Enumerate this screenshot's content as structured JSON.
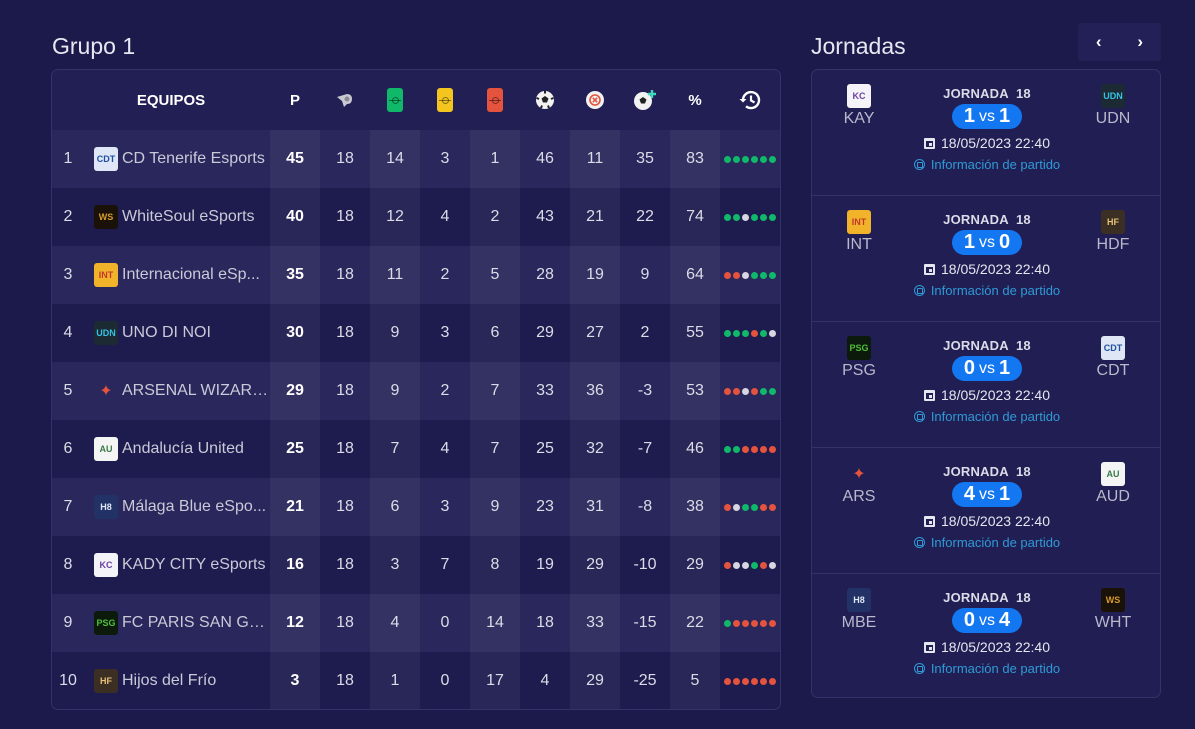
{
  "group": {
    "title": "Grupo 1",
    "headers": {
      "teams": "EQUIPOS",
      "points": "P",
      "played_icon": "whistle-icon",
      "won_icon": "green-pitch-icon",
      "drawn_icon": "yellow-pitch-icon",
      "lost_icon": "red-pitch-icon",
      "goals_for_icon": "soccer-ball-icon",
      "goals_against_icon": "soccer-ball-cross-icon",
      "goal_diff_icon": "soccer-ball-plus-icon",
      "percent": "%",
      "form_icon": "history-icon"
    },
    "colors": {
      "won": "#10b96a",
      "drawn": "#f4c51f",
      "lost": "#e4533d",
      "draw_dot": "#d6d5e0",
      "accent": "#1377f2",
      "link": "#2f9ad6"
    },
    "rows": [
      {
        "pos": "1",
        "team": "CD Tenerife Esports",
        "logo": "tenerife-logo",
        "pts": "45",
        "pj": "18",
        "w": "14",
        "d": "3",
        "l": "1",
        "gf": "46",
        "ga": "11",
        "gd": "35",
        "pct": "83",
        "form": [
          "G",
          "G",
          "G",
          "G",
          "G",
          "G"
        ]
      },
      {
        "pos": "2",
        "team": "WhiteSoul eSports",
        "logo": "whitesoul-logo",
        "pts": "40",
        "pj": "18",
        "w": "12",
        "d": "4",
        "l": "2",
        "gf": "43",
        "ga": "21",
        "gd": "22",
        "pct": "74",
        "form": [
          "G",
          "G",
          "D",
          "G",
          "G",
          "G"
        ]
      },
      {
        "pos": "3",
        "team": "Internacional eSp...",
        "logo": "internacional-logo",
        "pts": "35",
        "pj": "18",
        "w": "11",
        "d": "2",
        "l": "5",
        "gf": "28",
        "ga": "19",
        "gd": "9",
        "pct": "64",
        "form": [
          "R",
          "R",
          "D",
          "G",
          "G",
          "G"
        ]
      },
      {
        "pos": "4",
        "team": "UNO DI NOI",
        "logo": "uno-di-noi-logo",
        "pts": "30",
        "pj": "18",
        "w": "9",
        "d": "3",
        "l": "6",
        "gf": "29",
        "ga": "27",
        "gd": "2",
        "pct": "55",
        "form": [
          "G",
          "G",
          "G",
          "R",
          "G",
          "D"
        ]
      },
      {
        "pos": "5",
        "team": "ARSENAL WIZARDS",
        "logo": "arsenal-wizards-logo",
        "pts": "29",
        "pj": "18",
        "w": "9",
        "d": "2",
        "l": "7",
        "gf": "33",
        "ga": "36",
        "gd": "-3",
        "pct": "53",
        "form": [
          "R",
          "R",
          "D",
          "R",
          "G",
          "G"
        ]
      },
      {
        "pos": "6",
        "team": "Andalucía United",
        "logo": "andalucia-united-logo",
        "pts": "25",
        "pj": "18",
        "w": "7",
        "d": "4",
        "l": "7",
        "gf": "25",
        "ga": "32",
        "gd": "-7",
        "pct": "46",
        "form": [
          "G",
          "G",
          "R",
          "R",
          "R",
          "R"
        ]
      },
      {
        "pos": "7",
        "team": "Málaga Blue eSpo...",
        "logo": "malaga-blue-logo",
        "pts": "21",
        "pj": "18",
        "w": "6",
        "d": "3",
        "l": "9",
        "gf": "23",
        "ga": "31",
        "gd": "-8",
        "pct": "38",
        "form": [
          "R",
          "D",
          "G",
          "G",
          "R",
          "R"
        ]
      },
      {
        "pos": "8",
        "team": "KADY CITY eSports",
        "logo": "kady-city-logo",
        "pts": "16",
        "pj": "18",
        "w": "3",
        "d": "7",
        "l": "8",
        "gf": "19",
        "ga": "29",
        "gd": "-10",
        "pct": "29",
        "form": [
          "R",
          "D",
          "D",
          "G",
          "R",
          "D"
        ]
      },
      {
        "pos": "9",
        "team": "FC PARIS SAN GE...",
        "logo": "fc-paris-logo",
        "pts": "12",
        "pj": "18",
        "w": "4",
        "d": "0",
        "l": "14",
        "gf": "18",
        "ga": "33",
        "gd": "-15",
        "pct": "22",
        "form": [
          "G",
          "R",
          "R",
          "R",
          "R",
          "R"
        ]
      },
      {
        "pos": "10",
        "team": "Hijos del Frío",
        "logo": "hijos-del-frio-logo",
        "pts": "3",
        "pj": "18",
        "w": "1",
        "d": "0",
        "l": "17",
        "gf": "4",
        "ga": "29",
        "gd": "-25",
        "pct": "5",
        "form": [
          "R",
          "R",
          "R",
          "R",
          "R",
          "R"
        ]
      }
    ]
  },
  "jornadas": {
    "title": "Jornadas",
    "prev_label": "‹",
    "next_label": "›",
    "matches": [
      {
        "home": "KAY",
        "home_logo": "kady-city-logo",
        "away": "UDN",
        "away_logo": "uno-di-noi-logo",
        "round": "JORNADA  18",
        "home_score": "1",
        "vs": "VS",
        "away_score": "1",
        "date": "18/05/2023 22:40",
        "info": "Información de partido"
      },
      {
        "home": "INT",
        "home_logo": "internacional-logo",
        "away": "HDF",
        "away_logo": "hijos-del-frio-logo",
        "round": "JORNADA  18",
        "home_score": "1",
        "vs": "VS",
        "away_score": "0",
        "date": "18/05/2023 22:40",
        "info": "Información de partido"
      },
      {
        "home": "PSG",
        "home_logo": "fc-paris-logo",
        "away": "CDT",
        "away_logo": "tenerife-logo",
        "round": "JORNADA  18",
        "home_score": "0",
        "vs": "VS",
        "away_score": "1",
        "date": "18/05/2023 22:40",
        "info": "Información de partido"
      },
      {
        "home": "ARS",
        "home_logo": "arsenal-wizards-logo",
        "away": "AUD",
        "away_logo": "andalucia-united-logo",
        "round": "JORNADA  18",
        "home_score": "4",
        "vs": "VS",
        "away_score": "1",
        "date": "18/05/2023 22:40",
        "info": "Información de partido"
      },
      {
        "home": "MBE",
        "home_logo": "malaga-blue-logo",
        "away": "WHT",
        "away_logo": "whitesoul-logo",
        "round": "JORNADA  18",
        "home_score": "0",
        "vs": "VS",
        "away_score": "4",
        "date": "18/05/2023 22:40",
        "info": "Información de partido"
      }
    ]
  }
}
